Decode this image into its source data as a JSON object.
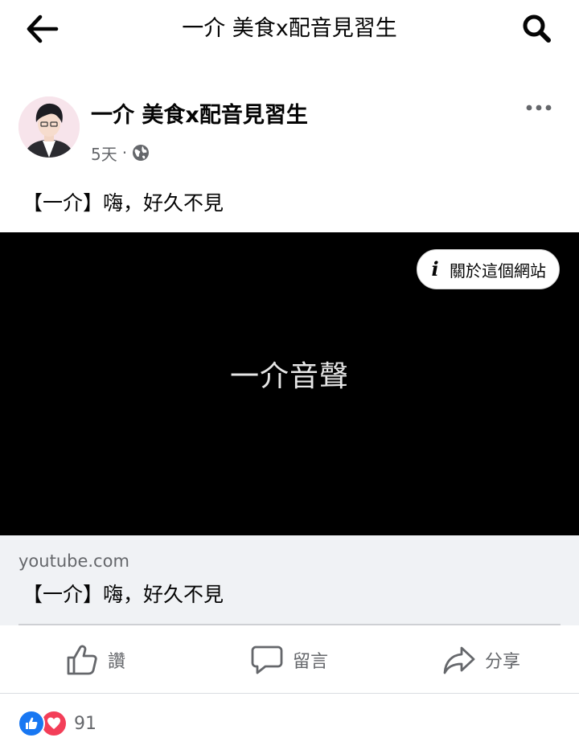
{
  "header": {
    "title": "一介 美食x配音見習生",
    "back_icon": "arrow-left-icon",
    "search_icon": "search-icon"
  },
  "post": {
    "author": "一介 美食x配音見習生",
    "time": "5天",
    "separator": "·",
    "privacy_icon": "globe-icon",
    "more_icon": "more-horizontal-icon",
    "text": "【一介】嗨，好久不見"
  },
  "media": {
    "title": "一介音聲",
    "about_site_label": "關於這個網站",
    "background_color": "#000000"
  },
  "link_preview": {
    "domain": "youtube.com",
    "title": "【一介】嗨，好久不見"
  },
  "actions": {
    "like_label": "讚",
    "comment_label": "留言",
    "share_label": "分享"
  },
  "reactions": {
    "count": "91",
    "icons": [
      "like-reaction-icon",
      "love-reaction-icon"
    ]
  },
  "colors": {
    "text_primary": "#050505",
    "text_secondary": "#65676b",
    "link_bg": "#f0f2f5",
    "like_blue": "#1877f2",
    "love_red": "#f33e58"
  }
}
